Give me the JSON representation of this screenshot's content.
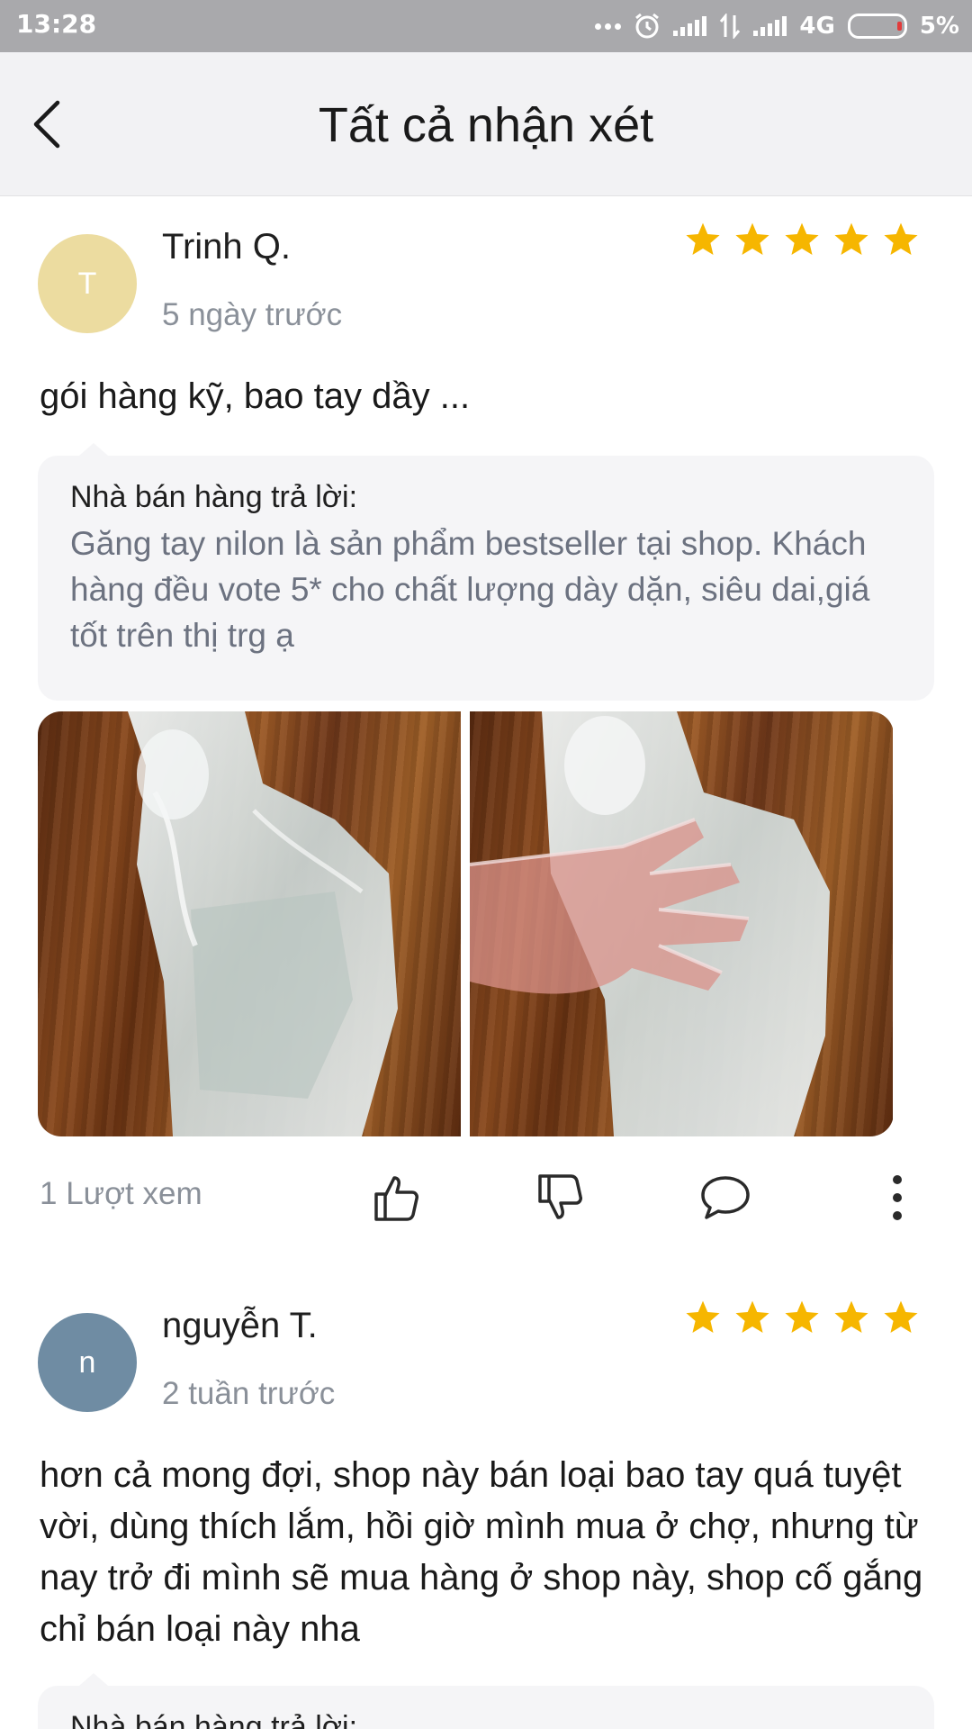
{
  "status_bar": {
    "time": "13:28",
    "network": "4G",
    "battery": "5%"
  },
  "header": {
    "title": "Tất cả nhận xét",
    "back_icon": "chevron-left-icon"
  },
  "colors": {
    "star": "#f6b600",
    "avatar_t": "#ecdca0",
    "avatar_n": "#6f8ca3",
    "muted_text": "#8a9099"
  },
  "reviews": [
    {
      "avatar_letter": "T",
      "name": "Trinh Q.",
      "date": "5 ngày trước",
      "rating": 5,
      "text": "gói hàng kỹ, bao tay dầy ...",
      "seller_reply": {
        "label": "Nhà bán hàng trả lời:",
        "text": "Găng tay nilon là sản phẩm bestseller tại shop. Khách hàng đều vote 5* cho chất lượng dày dặn, siêu dai,giá tốt trên thị trg ạ"
      },
      "photos": [
        "photo-gloves-pack",
        "photo-gloves-hand"
      ],
      "view_count": "1 Lượt xem"
    },
    {
      "avatar_letter": "n",
      "name": "nguyễn T.",
      "date": "2 tuần trước",
      "rating": 5,
      "text": "hơn cả mong đợi, shop này bán loại bao tay quá tuyệt vời, dùng thích lắm, hồi giờ mình mua ở chợ, nhưng từ nay trở đi mình sẽ mua hàng ở shop này, shop cố gắng chỉ bán loại này nha",
      "seller_reply": {
        "label": "Nhà bán hàng trả lời:"
      }
    }
  ]
}
